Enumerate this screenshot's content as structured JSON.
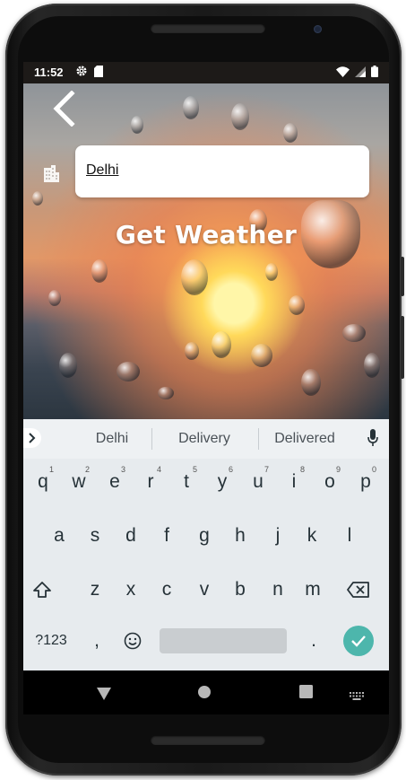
{
  "status_bar": {
    "time": "11:52",
    "left_icons": [
      "gear-icon",
      "sd-card-icon"
    ],
    "right_icons": [
      "wifi-icon",
      "cell-signal-icon",
      "battery-icon"
    ]
  },
  "app": {
    "back_icon": "chevron-left-icon",
    "city_icon": "city-building-icon",
    "city_input": {
      "value": "Delhi",
      "placeholder": ""
    },
    "action_label": "Get Weather"
  },
  "keyboard": {
    "suggestions": [
      "Delhi",
      "Delivery",
      "Delivered"
    ],
    "row1": [
      {
        "key": "q",
        "hint": "1"
      },
      {
        "key": "w",
        "hint": "2"
      },
      {
        "key": "e",
        "hint": "3"
      },
      {
        "key": "r",
        "hint": "4"
      },
      {
        "key": "t",
        "hint": "5"
      },
      {
        "key": "y",
        "hint": "6"
      },
      {
        "key": "u",
        "hint": "7"
      },
      {
        "key": "i",
        "hint": "8"
      },
      {
        "key": "o",
        "hint": "9"
      },
      {
        "key": "p",
        "hint": "0"
      }
    ],
    "row2": [
      "a",
      "s",
      "d",
      "f",
      "g",
      "h",
      "j",
      "k",
      "l"
    ],
    "row3": [
      "z",
      "x",
      "c",
      "v",
      "b",
      "n",
      "m"
    ],
    "symbols_label": "?123",
    "comma": ",",
    "period": ".",
    "accent_color": "#4db6ac"
  },
  "nav_bar": {
    "icons": [
      "back-triangle-icon",
      "home-circle-icon",
      "recents-square-icon",
      "keyboard-switch-icon"
    ]
  }
}
